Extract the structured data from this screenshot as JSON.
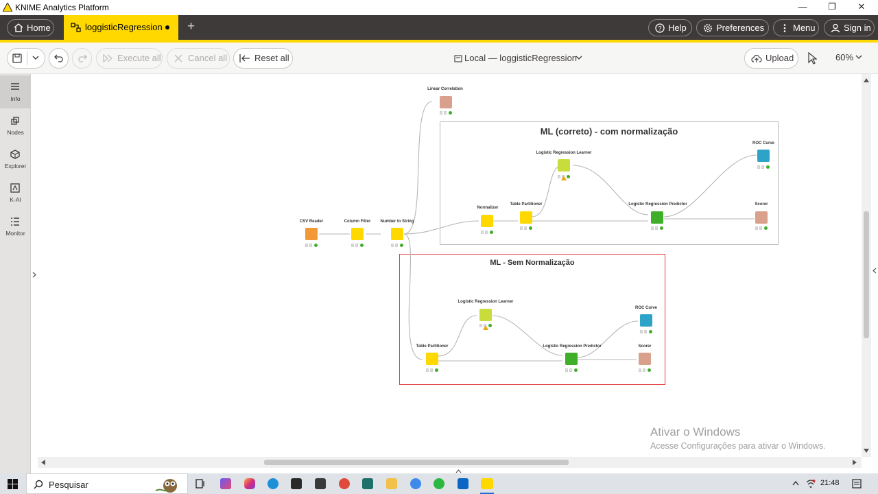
{
  "window": {
    "app_title": "KNIME Analytics Platform",
    "minimize": "—",
    "restore": "❐",
    "close": "✕"
  },
  "appbar": {
    "home_label": "Home",
    "active_tab_label": "loggisticRegression",
    "add_tab": "+",
    "help_label": "Help",
    "preferences_label": "Preferences",
    "menu_label": "Menu",
    "signin_label": "Sign in"
  },
  "toolbar": {
    "execute_all": "Execute all",
    "cancel_all": "Cancel all",
    "reset_all": "Reset all",
    "breadcrumb": "Local — loggisticRegression",
    "upload": "Upload",
    "zoom": "60%"
  },
  "sidebar": {
    "items": [
      {
        "label": "Info",
        "icon": "info-icon"
      },
      {
        "label": "Nodes",
        "icon": "nodes-icon"
      },
      {
        "label": "Explorer",
        "icon": "explorer-icon"
      },
      {
        "label": "K-AI",
        "icon": "kai-icon"
      },
      {
        "label": "Monitor",
        "icon": "monitor-icon"
      }
    ]
  },
  "workflow": {
    "annotations": [
      {
        "title": "ML (correto) - com normalização",
        "border": "#b9b9b9"
      },
      {
        "title": "ML - Sem Normalização",
        "border": "#e03c3c"
      }
    ],
    "nodes": [
      {
        "label": "CSV Reader",
        "color": "#f29837"
      },
      {
        "label": "Column Filter",
        "color": "#ffd800"
      },
      {
        "label": "Number to String",
        "color": "#ffd800"
      },
      {
        "label": "Linear Correlation",
        "color": "#d9a18c"
      },
      {
        "label": "Normalizer",
        "color": "#ffd800"
      },
      {
        "label": "Table Partitioner",
        "color": "#ffd800"
      },
      {
        "label": "Logistic Regression Learner",
        "color": "#c8dc3c"
      },
      {
        "label": "Logistic Regression Predictor",
        "color": "#3fae29"
      },
      {
        "label": "ROC Curve",
        "color": "#2da3c8"
      },
      {
        "label": "Scorer",
        "color": "#d9a18c"
      },
      {
        "label": "Table Partitioner",
        "color": "#ffd800"
      },
      {
        "label": "Logistic Regression Learner",
        "color": "#c8dc3c"
      },
      {
        "label": "Logistic Regression Predictor",
        "color": "#3fae29"
      },
      {
        "label": "ROC Curve",
        "color": "#2da3c8"
      },
      {
        "label": "Scorer",
        "color": "#d9a18c"
      }
    ]
  },
  "watermark": {
    "line1": "Ativar o Windows",
    "line2": "Acesse Configurações para ativar o Windows."
  },
  "taskbar": {
    "search_placeholder": "Pesquisar",
    "time": "21:48"
  },
  "colors": {
    "accent_yellow": "#ffd800",
    "appbar_dark": "#3e3a39"
  }
}
